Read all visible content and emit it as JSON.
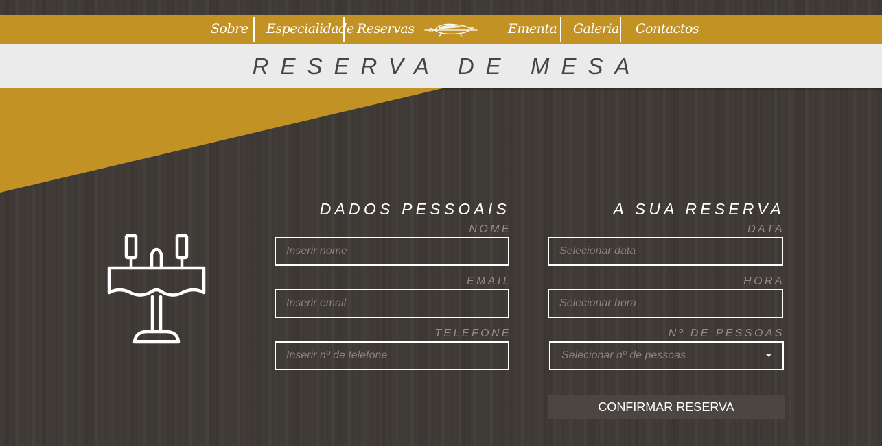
{
  "nav": {
    "items": [
      "Sobre",
      "Especialidade",
      "Reservas",
      "Ementa",
      "Galeria",
      "Contactos"
    ],
    "logo_icon": "roast-pig-logo-icon"
  },
  "page_title": "RESERVA DE MESA",
  "personal": {
    "title": "DADOS PESSOAIS",
    "name_label": "NOME",
    "name_placeholder": "Inserir nome",
    "email_label": "EMAIL",
    "email_placeholder": "Inserir email",
    "phone_label": "TELEFONE",
    "phone_placeholder": "Inserir nº de telefone"
  },
  "reservation": {
    "title": "A SUA RESERVA",
    "date_label": "DATA",
    "date_placeholder": "Selecionar data",
    "time_label": "HORA",
    "time_placeholder": "Selecionar hora",
    "people_label": "Nº DE PESSOAS",
    "people_placeholder": "Selecionar nº de pessoas"
  },
  "confirm_label": "CONFIRMAR RESERVA",
  "decor": {
    "table_icon": "dining-table-icon"
  },
  "colors": {
    "accent_gold": "#c29225",
    "background_wood": "#403b37",
    "title_band": "#ebebeb",
    "label_muted": "#9a8e81",
    "button_bg": "#4c4642"
  }
}
